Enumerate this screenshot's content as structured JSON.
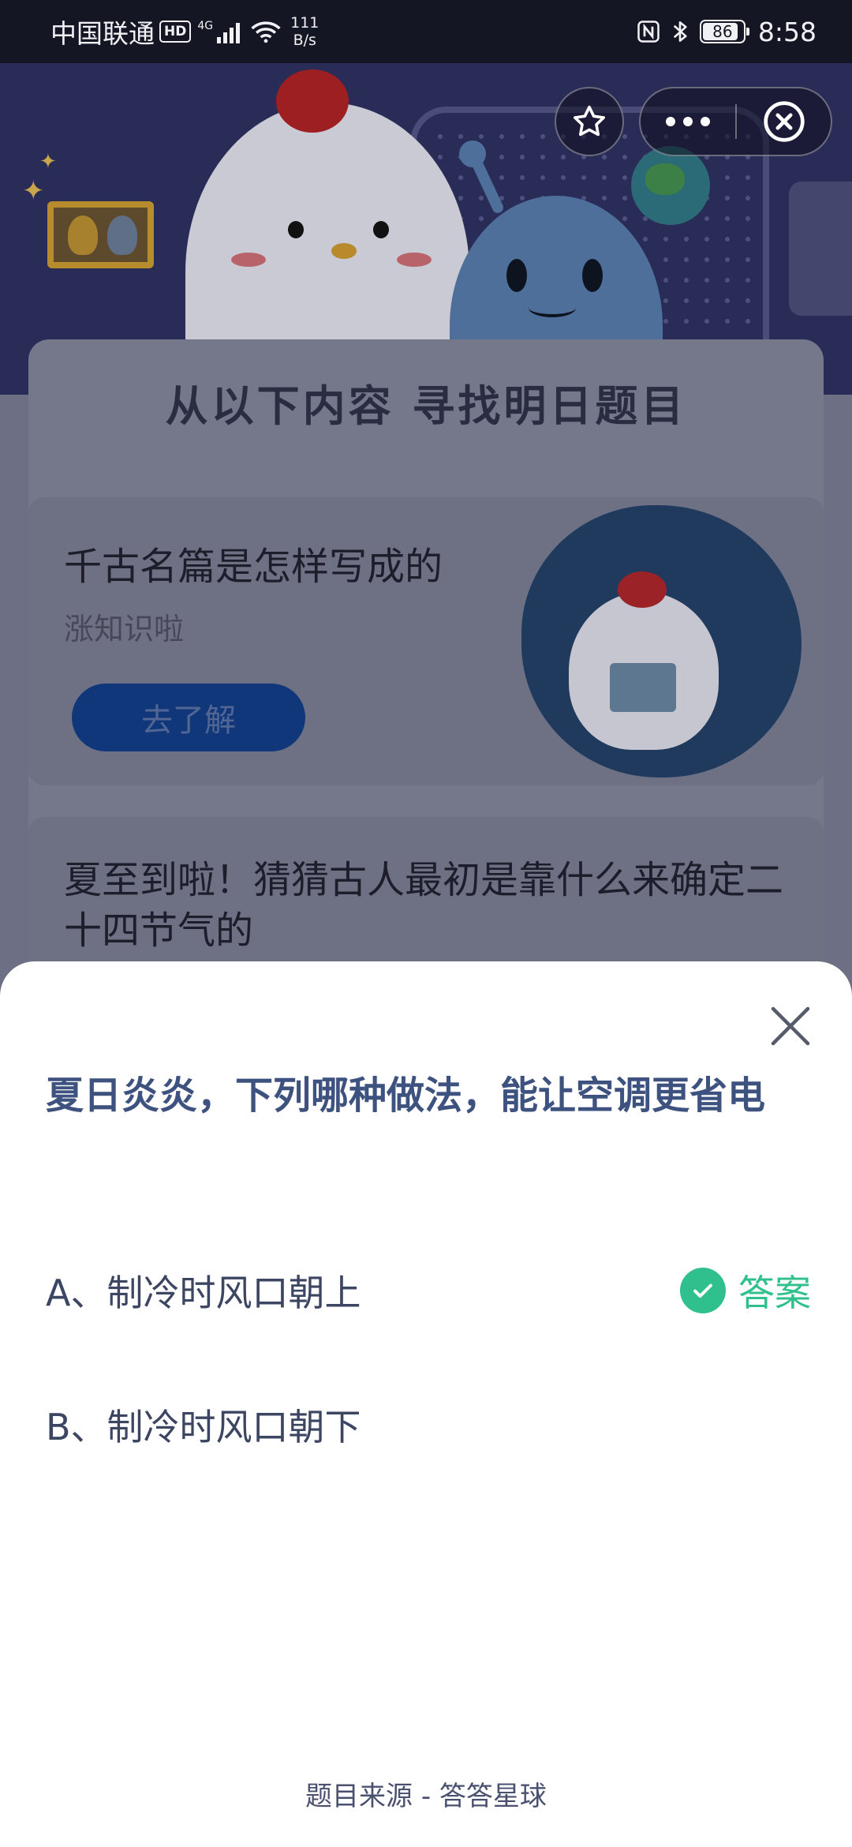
{
  "status_bar": {
    "carrier": "中国联通",
    "hd": "HD",
    "network": "4G",
    "speed_value": "111",
    "speed_unit": "B/s",
    "battery": "86",
    "time": "8:58"
  },
  "background_page": {
    "banner_title": "从以下内容 寻找明日题目",
    "cards": [
      {
        "title": "千古名篇是怎样写成的",
        "subtitle": "涨知识啦",
        "button": "去了解"
      },
      {
        "title": "夏至到啦！猜猜古人最初是靠什么来确定二十四节气的"
      }
    ]
  },
  "sheet": {
    "question": "夏日炎炎，下列哪种做法，能让空调更省电",
    "options": [
      {
        "label": "A、制冷时风口朝上",
        "answer_tag": "答案"
      },
      {
        "label": "B、制冷时风口朝下"
      }
    ],
    "footer": "题目来源 - 答答星球"
  },
  "colors": {
    "accent_green": "#2fc08d",
    "question_blue": "#3e5280",
    "hero_bg": "#2a2c58"
  }
}
